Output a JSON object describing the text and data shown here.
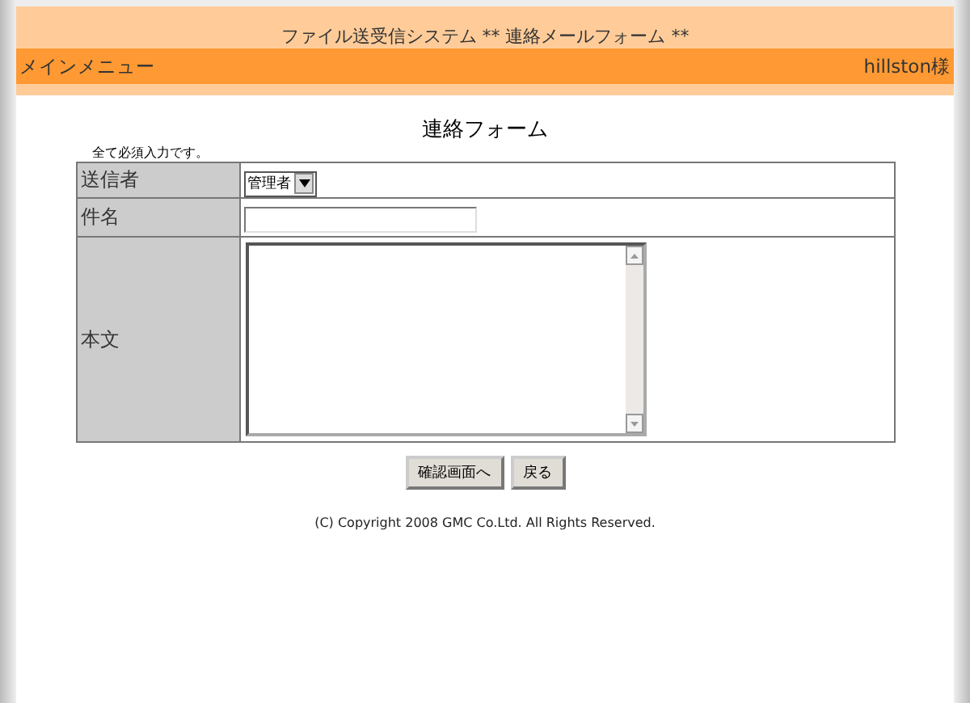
{
  "header": {
    "title": "ファイル送受信システム ** 連絡メールフォーム **",
    "menu_link": "メインメニュー",
    "user": "hillston様"
  },
  "form": {
    "title": "連絡フォーム",
    "note": "全て必須入力です。",
    "rows": [
      {
        "label": "送信者",
        "kind": "select",
        "value": "管理者"
      },
      {
        "label": "件名",
        "kind": "text"
      },
      {
        "label": "本文",
        "kind": "textarea"
      }
    ]
  },
  "buttons": [
    "確認画面へ",
    "戻る"
  ],
  "footer": "(C) Copyright 2008 GMC Co.Ltd. All Rights Reserved."
}
